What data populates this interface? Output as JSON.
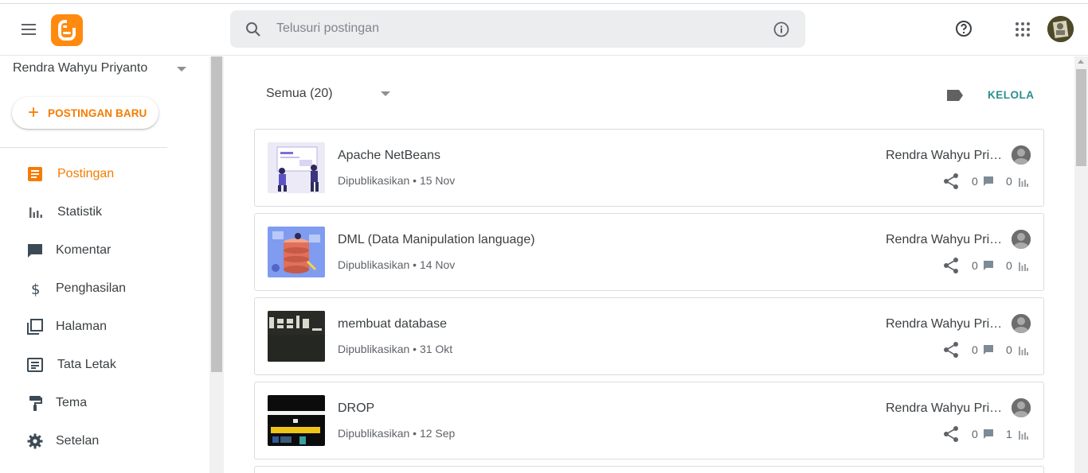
{
  "header": {
    "search_placeholder": "Telusuri postingan",
    "brand_color": "#ff8a0f"
  },
  "sidebar": {
    "blog_name": "Rendra Wahyu Priyanto",
    "new_post_label": "POSTINGAN BARU",
    "items": [
      {
        "label": "Postingan",
        "icon": "posts-icon",
        "active": true
      },
      {
        "label": "Statistik",
        "icon": "stats-icon"
      },
      {
        "label": "Komentar",
        "icon": "comment-icon"
      },
      {
        "label": "Penghasilan",
        "icon": "dollar-icon"
      },
      {
        "label": "Halaman",
        "icon": "pages-icon"
      },
      {
        "label": "Tata Letak",
        "icon": "layout-icon"
      },
      {
        "label": "Tema",
        "icon": "paint-roller-icon"
      },
      {
        "label": "Setelan",
        "icon": "gear-icon"
      }
    ]
  },
  "main": {
    "filter_label": "Semua (20)",
    "manage_label": "KELOLA",
    "posts": [
      {
        "title": "Apache NetBeans",
        "status": "Dipublikasikan • 15 Nov",
        "author": "Rendra Wahyu Priyanto",
        "comments": "0",
        "views": "0"
      },
      {
        "title": "DML (Data Manipulation language)",
        "status": "Dipublikasikan • 14 Nov",
        "author": "Rendra Wahyu Priyanto",
        "comments": "0",
        "views": "0"
      },
      {
        "title": "membuat database",
        "status": "Dipublikasikan • 31 Okt",
        "author": "Rendra Wahyu Priyanto",
        "comments": "0",
        "views": "0"
      },
      {
        "title": "DROP",
        "status": "Dipublikasikan • 12 Sep",
        "author": "Rendra Wahyu Priyanto",
        "comments": "0",
        "views": "1"
      }
    ]
  },
  "colors": {
    "accent": "#f57c00",
    "teal": "#2a8f8f"
  }
}
